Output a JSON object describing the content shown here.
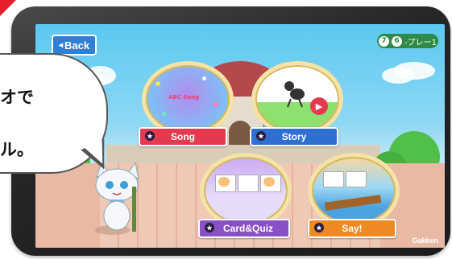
{
  "app": {
    "back_label": "Back",
    "page_indicator": {
      "unit": "7",
      "lesson": "6",
      "suffix": "-プレー1"
    },
    "brand": "Gakken"
  },
  "menu": [
    {
      "label": "Song",
      "thumb_text": "ABC Song",
      "color": "#e33a4f"
    },
    {
      "label": "Story",
      "color": "#2f6fd1"
    },
    {
      "label": "Card&Quiz",
      "color": "#8b4fc6"
    },
    {
      "label": "Say!",
      "color": "#ef8a23"
    }
  ],
  "bubble": {
    "line1": "オで",
    "line2": "ル。"
  },
  "colors": {
    "accent_red": "#e3202b",
    "back_blue": "#2f7fd6",
    "indicator_green": "#2e8a46"
  }
}
